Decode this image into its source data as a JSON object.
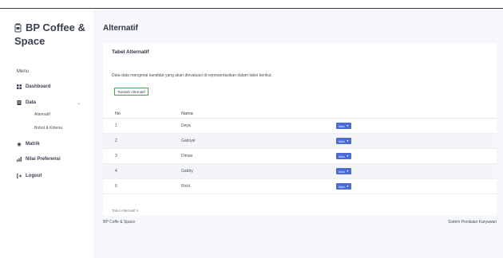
{
  "brand": {
    "line1": "BP Coffee &",
    "line2": "Space"
  },
  "sidebar": {
    "menu_header": "Menu",
    "items": [
      {
        "label": "Dashboard",
        "icon": "grid-icon"
      },
      {
        "label": "Data",
        "icon": "document-icon"
      },
      {
        "label": "Matrik",
        "icon": "star-icon"
      },
      {
        "label": "Nilai Preferensi",
        "icon": "bar-chart-icon"
      },
      {
        "label": "Logout",
        "icon": "logout-icon"
      }
    ],
    "data_subitems": [
      {
        "label": "Alternatif"
      },
      {
        "label": "Bobot & Kriteria"
      }
    ]
  },
  "page": {
    "title": "Alternatif"
  },
  "card": {
    "title": "Tabel Alternatif",
    "description": "Data-data mengenai kandidat yang akan dievaluasi di representasikan dalam tabel berikut.",
    "add_button": "Tambah Alternatif",
    "table_caption": "Tabel Alternatif A."
  },
  "table": {
    "headers": {
      "no": "No",
      "name": "Nama",
      "action": ""
    },
    "rows": [
      {
        "no": "1",
        "name": "Deya",
        "action": "Aksi"
      },
      {
        "no": "2",
        "name": "Gabryel",
        "action": "Aksi"
      },
      {
        "no": "3",
        "name": "Dimas",
        "action": "Aksi"
      },
      {
        "no": "4",
        "name": "Gabby",
        "action": "Aksi"
      },
      {
        "no": "5",
        "name": "Richi",
        "action": "Aksi"
      }
    ]
  },
  "footer": {
    "left": "BP Coffe & Space",
    "right": "Sistem Penilaian Karyawan"
  },
  "colors": {
    "primary": "#4b6bd6",
    "success": "#3fa34d",
    "main_bg": "#f5f7fb"
  }
}
